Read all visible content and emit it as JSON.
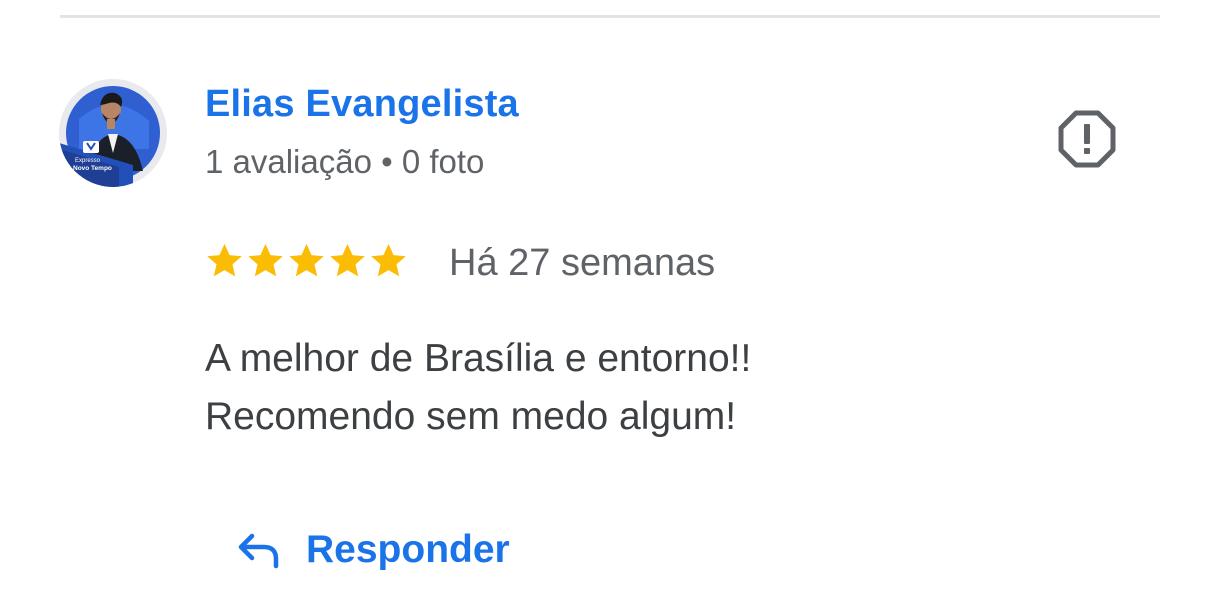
{
  "review": {
    "reviewer_name": "Elias Evangelista",
    "reviewer_meta": "1 avaliação • 0 foto",
    "rating": 5,
    "rating_max": 5,
    "time_ago": "Há 27 semanas",
    "text_lines": [
      "A melhor de Brasília e entorno!!",
      "Recomendo sem medo algum!"
    ],
    "reply_label": "Responder"
  },
  "avatar": {
    "logo_text_line1": "Expresso",
    "logo_text_line2": "Novo Tempo"
  },
  "icons": {
    "report": "report-flag-icon",
    "reply": "reply-arrow-icon",
    "star": "star-icon"
  },
  "colors": {
    "accent": "#1a73e8",
    "star": "#fbbc04",
    "secondary_text": "#5f6368",
    "body_text": "#3c4043",
    "divider": "#e3e3e3"
  }
}
